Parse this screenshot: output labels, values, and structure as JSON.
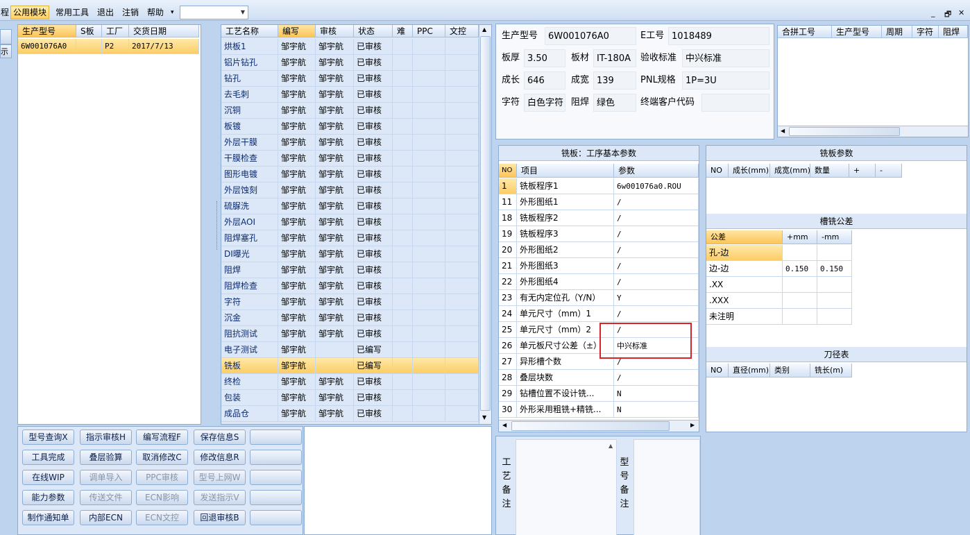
{
  "menu": {
    "edge_label": "程",
    "items": [
      "公用模块",
      "常用工具",
      "退出",
      "注销",
      "帮助"
    ],
    "active_index": 0,
    "help_arrow": "▾",
    "module_select_value": "",
    "window_controls": [
      "_",
      "🗗",
      "✕"
    ]
  },
  "left_edge": {
    "labels": [
      "",
      "示"
    ]
  },
  "product_list": {
    "headers": [
      "生产型号",
      "S板",
      "工厂",
      "交货日期"
    ],
    "rows": [
      {
        "model": "6W001076A0",
        "s": "",
        "factory": "P2",
        "date": "2017/7/13"
      }
    ]
  },
  "process_table": {
    "headers": [
      "工艺名称",
      "编写",
      "审核",
      "状态",
      "难",
      "PPC",
      "文控"
    ],
    "rows": [
      [
        "烘板1",
        "邹宇航",
        "邹宇航",
        "已审核"
      ],
      [
        "铝片钻孔",
        "邹宇航",
        "邹宇航",
        "已审核"
      ],
      [
        "钻孔",
        "邹宇航",
        "邹宇航",
        "已审核"
      ],
      [
        "去毛刺",
        "邹宇航",
        "邹宇航",
        "已审核"
      ],
      [
        "沉铜",
        "邹宇航",
        "邹宇航",
        "已审核"
      ],
      [
        "板镀",
        "邹宇航",
        "邹宇航",
        "已审核"
      ],
      [
        "外层干膜",
        "邹宇航",
        "邹宇航",
        "已审核"
      ],
      [
        "干膜检查",
        "邹宇航",
        "邹宇航",
        "已审核"
      ],
      [
        "图形电镀",
        "邹宇航",
        "邹宇航",
        "已审核"
      ],
      [
        "外层蚀刻",
        "邹宇航",
        "邹宇航",
        "已审核"
      ],
      [
        "硫脲洗",
        "邹宇航",
        "邹宇航",
        "已审核"
      ],
      [
        "外层AOI",
        "邹宇航",
        "邹宇航",
        "已审核"
      ],
      [
        "阻焊塞孔",
        "邹宇航",
        "邹宇航",
        "已审核"
      ],
      [
        "DI曝光",
        "邹宇航",
        "邹宇航",
        "已审核"
      ],
      [
        "阻焊",
        "邹宇航",
        "邹宇航",
        "已审核"
      ],
      [
        "阻焊检查",
        "邹宇航",
        "邹宇航",
        "已审核"
      ],
      [
        "字符",
        "邹宇航",
        "邹宇航",
        "已审核"
      ],
      [
        "沉金",
        "邹宇航",
        "邹宇航",
        "已审核"
      ],
      [
        "阻抗测试",
        "邹宇航",
        "邹宇航",
        "已审核"
      ],
      [
        "电子测试",
        "邹宇航",
        "",
        "已编写"
      ],
      [
        "铣板",
        "邹宇航",
        "",
        "已编写"
      ],
      [
        "终检",
        "邹宇航",
        "邹宇航",
        "已审核"
      ],
      [
        "包装",
        "邹宇航",
        "邹宇航",
        "已审核"
      ],
      [
        "成品仓",
        "邹宇航",
        "邹宇航",
        "已审核"
      ]
    ],
    "selected_index": 20
  },
  "buttons": [
    {
      "label": "型号查询X",
      "enabled": true
    },
    {
      "label": "指示审核H",
      "enabled": true
    },
    {
      "label": "编写流程F",
      "enabled": true
    },
    {
      "label": "保存信息S",
      "enabled": true
    },
    {
      "label": "",
      "enabled": true
    },
    {
      "label": "工具完成",
      "enabled": true
    },
    {
      "label": "叠层验算",
      "enabled": true
    },
    {
      "label": "取消修改C",
      "enabled": true
    },
    {
      "label": "修改信息R",
      "enabled": true
    },
    {
      "label": "",
      "enabled": true
    },
    {
      "label": "在线WIP",
      "enabled": true
    },
    {
      "label": "调单导入",
      "enabled": false
    },
    {
      "label": "PPC审核",
      "enabled": false
    },
    {
      "label": "型号上网W",
      "enabled": false
    },
    {
      "label": "",
      "enabled": true
    },
    {
      "label": "能力参数",
      "enabled": true
    },
    {
      "label": "传送文件",
      "enabled": false
    },
    {
      "label": "ECN影响",
      "enabled": false
    },
    {
      "label": "发送指示V",
      "enabled": false
    },
    {
      "label": "",
      "enabled": true
    },
    {
      "label": "制作通知单",
      "enabled": true
    },
    {
      "label": "内部ECN",
      "enabled": true
    },
    {
      "label": "ECN文控",
      "enabled": false
    },
    {
      "label": "回退审核B",
      "enabled": true
    },
    {
      "label": "",
      "enabled": true
    }
  ],
  "info": {
    "model_label": "生产型号",
    "model": "6W001076A0",
    "eno_label": "E工号",
    "eno": "1018489",
    "thickness_label": "板厚",
    "thickness": "3.50",
    "material_label": "板材",
    "material": "IT-180A",
    "standard_label": "验收标准",
    "standard": "中兴标准",
    "length_label": "成长",
    "length": "646",
    "width_label": "成宽",
    "width": "139",
    "pnl_label": "PNL规格",
    "pnl": "1P=3U",
    "char_label": "字符",
    "char": "白色字符",
    "mask_label": "阻焊",
    "mask": "绿色",
    "customer_label": "终端客户代码",
    "customer": ""
  },
  "merge_table": {
    "headers": [
      "合拼工号",
      "生产型号",
      "周期",
      "字符",
      "阻焊"
    ]
  },
  "mill_params": {
    "title": "铣板：工序基本参数",
    "headers": [
      "NO",
      "项目",
      "参数"
    ],
    "rows": [
      [
        "1",
        "铣板程序1",
        "6w001076a0.ROU"
      ],
      [
        "11",
        "外形图纸1",
        "/"
      ],
      [
        "18",
        "铣板程序2",
        "/"
      ],
      [
        "19",
        "铣板程序3",
        "/"
      ],
      [
        "20",
        "外形图纸2",
        "/"
      ],
      [
        "21",
        "外形图纸3",
        "/"
      ],
      [
        "22",
        "外形图纸4",
        "/"
      ],
      [
        "23",
        "有无内定位孔（Y/N）",
        "Y"
      ],
      [
        "24",
        "单元尺寸（mm）1",
        "/"
      ],
      [
        "25",
        "单元尺寸（mm）2",
        "/"
      ],
      [
        "26",
        "单元板尺寸公差（±）",
        "中兴标准"
      ],
      [
        "27",
        "异形槽个数",
        "/"
      ],
      [
        "28",
        "叠层块数",
        "/"
      ],
      [
        "29",
        "钻槽位置不设计铣...",
        "N"
      ],
      [
        "30",
        "外形采用粗铣+精铣...",
        "N"
      ]
    ]
  },
  "mill_board": {
    "title": "铣板参数",
    "headers": [
      "NO",
      "成长(mm)",
      "成宽(mm)",
      "数量",
      "+",
      "-"
    ]
  },
  "slot_tolerance": {
    "title": "槽铣公差",
    "headers": [
      "公差",
      "+mm",
      "-mm"
    ],
    "rows": [
      [
        "孔-边",
        "",
        ""
      ],
      [
        "边-边",
        "0.150",
        "0.150"
      ],
      [
        ".XX",
        "",
        ""
      ],
      [
        ".XXX",
        "",
        ""
      ],
      [
        "未注明",
        "",
        ""
      ]
    ]
  },
  "tool_table": {
    "title": "刀径表",
    "headers": [
      "NO",
      "直径(mm)",
      "类别",
      "铣长(m)"
    ]
  },
  "notes": {
    "process_label": "工艺备注",
    "model_label": "型号备注"
  }
}
